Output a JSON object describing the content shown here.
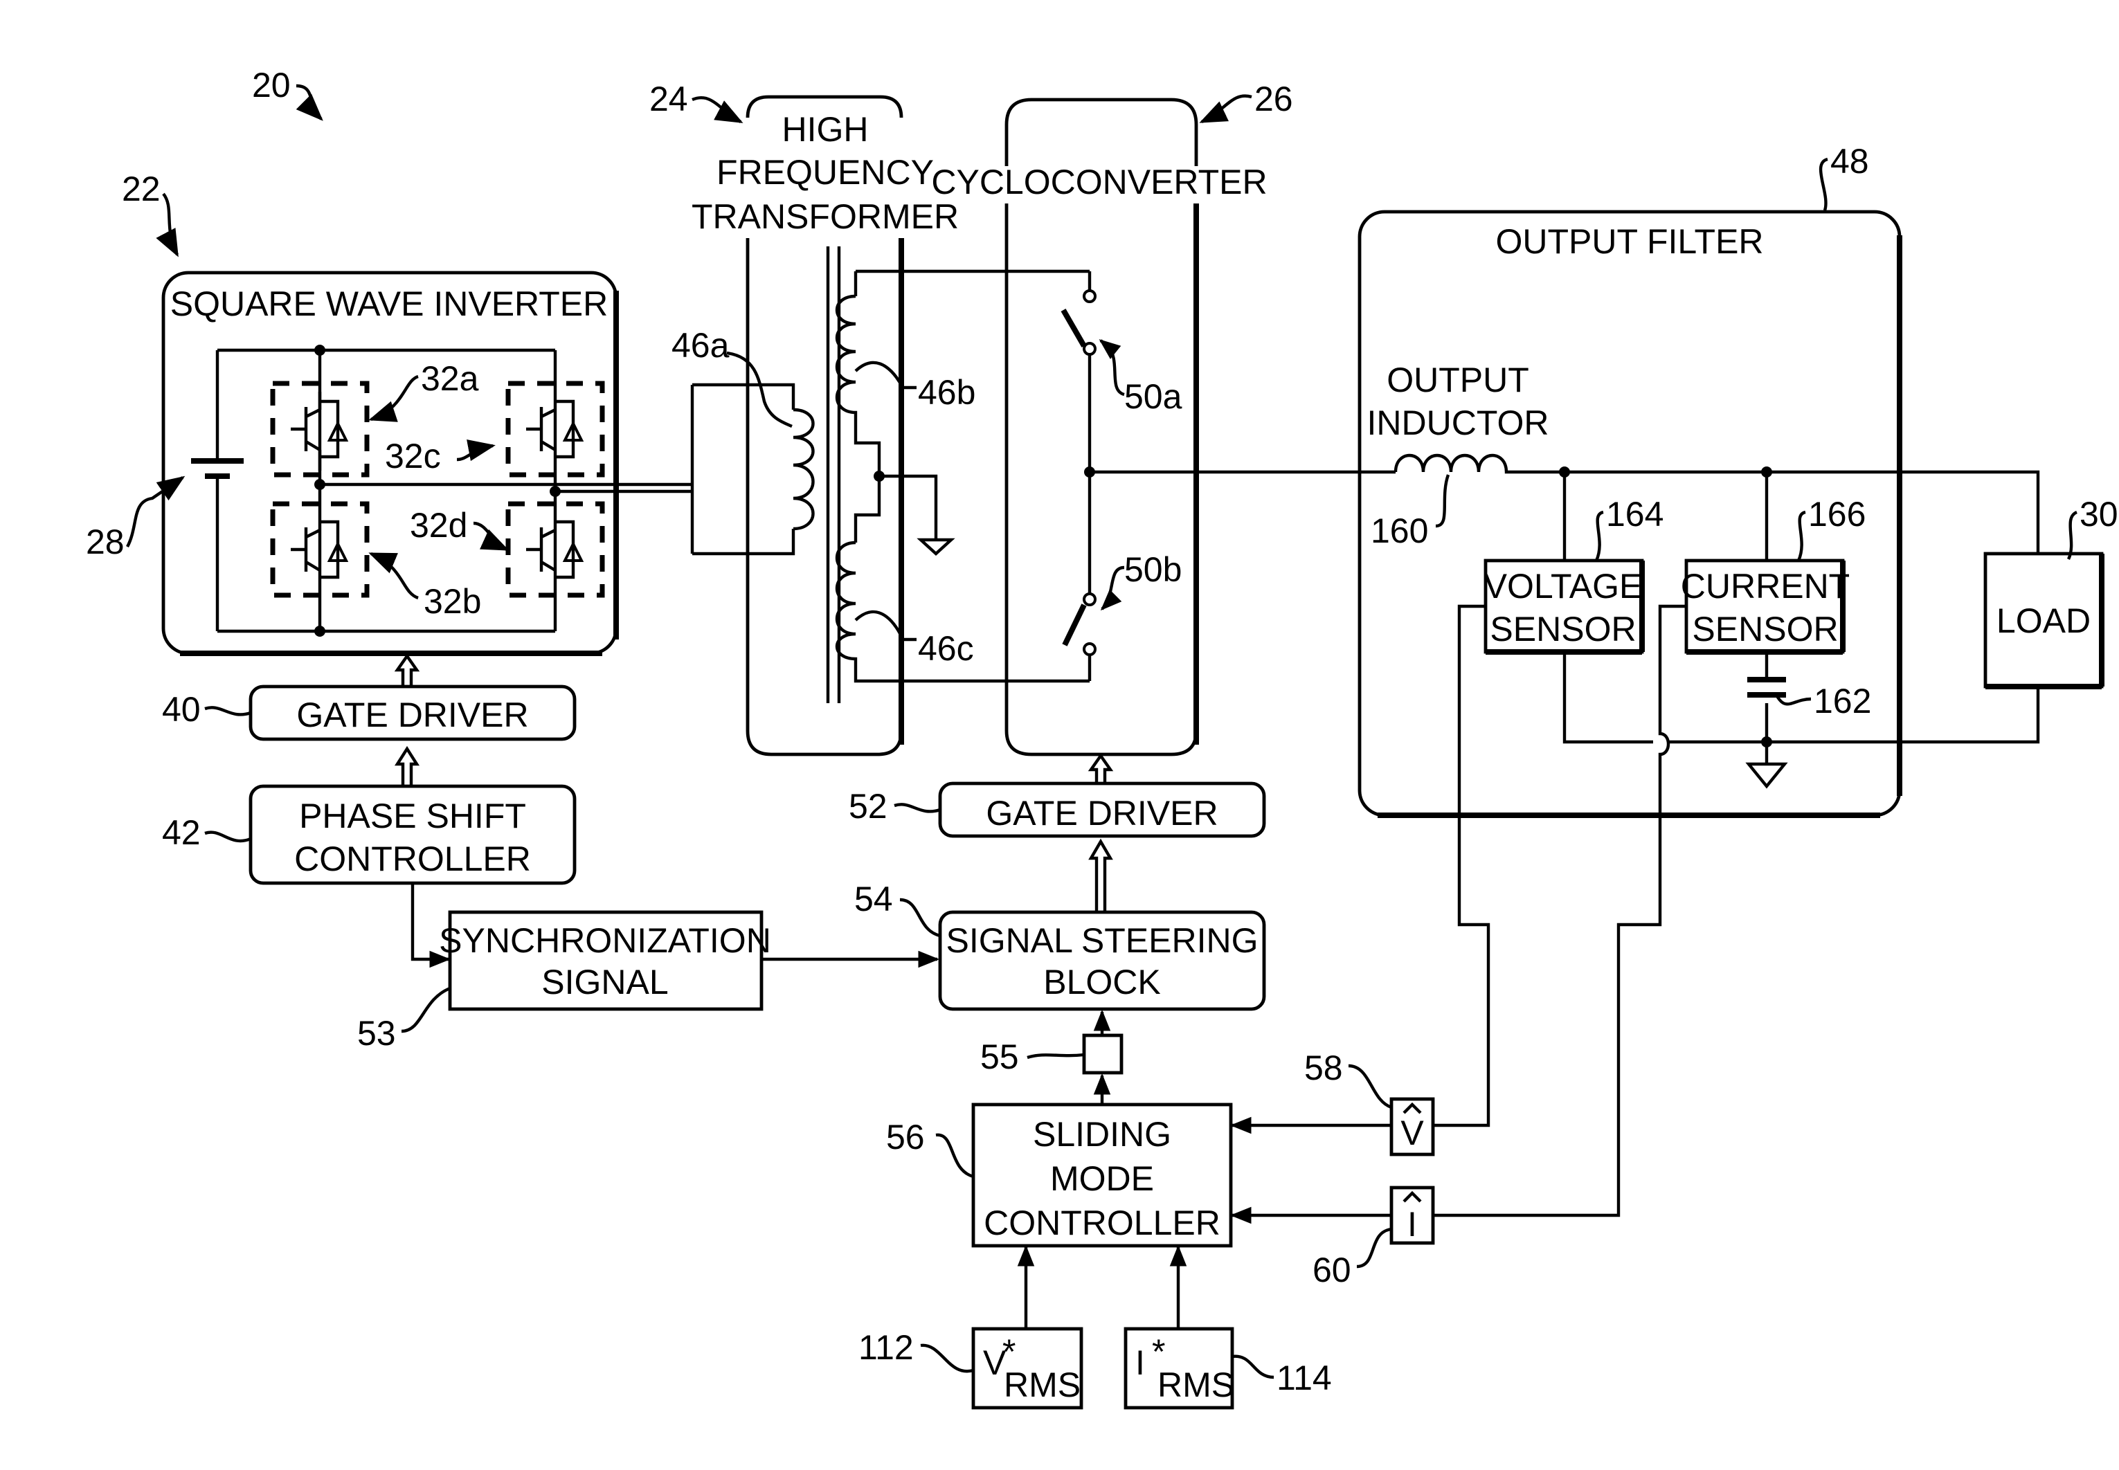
{
  "figure": {
    "ref": "20",
    "blocks": {
      "inverter": {
        "title": "SQUARE WAVE INVERTER",
        "ref": "22",
        "battery_ref": "28",
        "switches": [
          "32a",
          "32b",
          "32c",
          "32d"
        ]
      },
      "transformer": {
        "title_lines": [
          "HIGH",
          "FREQUENCY",
          "TRANSFORMER"
        ],
        "ref": "24",
        "windings": [
          "46a",
          "46b",
          "46c"
        ]
      },
      "cycloconverter": {
        "title": "CYCLOCONVERTER",
        "ref": "26",
        "switches": [
          "50a",
          "50b"
        ]
      },
      "output_filter": {
        "title": "OUTPUT FILTER",
        "ref": "48",
        "inductor_label_lines": [
          "OUTPUT",
          "INDUCTOR"
        ],
        "inductor_ref": "160",
        "capacitor_ref": "162",
        "voltage_sensor": {
          "lines": [
            "VOLTAGE",
            "SENSOR"
          ],
          "ref": "164"
        },
        "current_sensor": {
          "lines": [
            "CURRENT",
            "SENSOR"
          ],
          "ref": "166"
        }
      },
      "load": {
        "label": "LOAD",
        "ref": "30"
      },
      "gate_driver_1": {
        "label": "GATE DRIVER",
        "ref": "40"
      },
      "phase_shift": {
        "lines": [
          "PHASE SHIFT",
          "CONTROLLER"
        ],
        "ref": "42"
      },
      "sync": {
        "lines": [
          "SYNCHRONIZATION",
          "SIGNAL"
        ],
        "ref": "53"
      },
      "gate_driver_2": {
        "label": "GATE DRIVER",
        "ref": "52"
      },
      "steering": {
        "lines": [
          "SIGNAL STEERING",
          "BLOCK"
        ],
        "ref": "54"
      },
      "small_block": {
        "ref": "55"
      },
      "sliding": {
        "lines": [
          "SLIDING",
          "MODE",
          "CONTROLLER"
        ],
        "ref": "56"
      },
      "v_hat": {
        "symbol": "V",
        "ref": "58"
      },
      "i_hat": {
        "symbol": "I",
        "ref": "60"
      },
      "v_rms": {
        "main": "V",
        "sup": "*",
        "sub": "RMS",
        "ref": "112"
      },
      "i_rms": {
        "main": "I",
        "sup": "*",
        "sub": "RMS",
        "ref": "114"
      }
    }
  }
}
